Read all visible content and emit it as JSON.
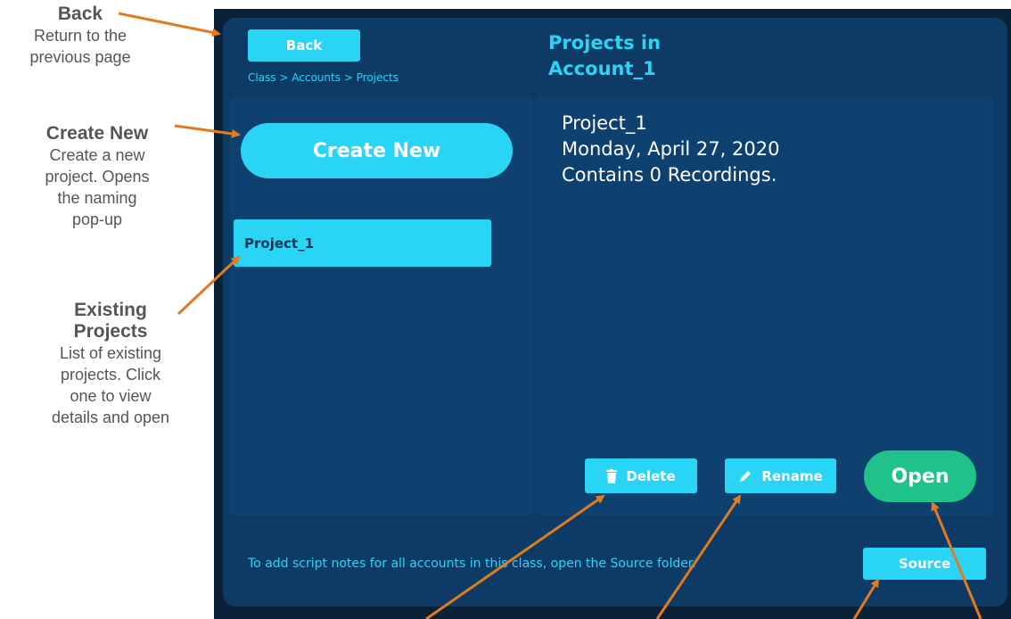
{
  "annotations": {
    "back": {
      "title": "Back",
      "line1": "Return to the",
      "line2": "previous page"
    },
    "create_new": {
      "title": "Create New",
      "line1": "Create a new",
      "line2": "project. Opens",
      "line3": "the naming",
      "line4": "pop-up"
    },
    "existing": {
      "title1": "Existing",
      "title2": "Projects",
      "line1": "List of existing",
      "line2": "projects. Click",
      "line3": "one to view",
      "line4": "details and open"
    }
  },
  "header": {
    "back_label": "Back",
    "breadcrumb": "Class  >  Accounts  >  Projects",
    "title_line1": "Projects in",
    "title_line2": "Account_1"
  },
  "sidebar": {
    "create_label": "Create New",
    "projects": [
      {
        "label": "Project_1"
      }
    ]
  },
  "details": {
    "name": "Project_1",
    "date": "Monday, April 27, 2020",
    "contents": "Contains 0 Recordings."
  },
  "actions": {
    "delete_label": "Delete",
    "rename_label": "Rename",
    "open_label": "Open"
  },
  "footer": {
    "text": "To add script notes for all accounts in this class, open the Source folder.",
    "source_label": "Source"
  },
  "colors": {
    "accent": "#2ad4f5",
    "panel": "#0e3a66",
    "open": "#1ec28a",
    "arrow": "#e07b22"
  }
}
